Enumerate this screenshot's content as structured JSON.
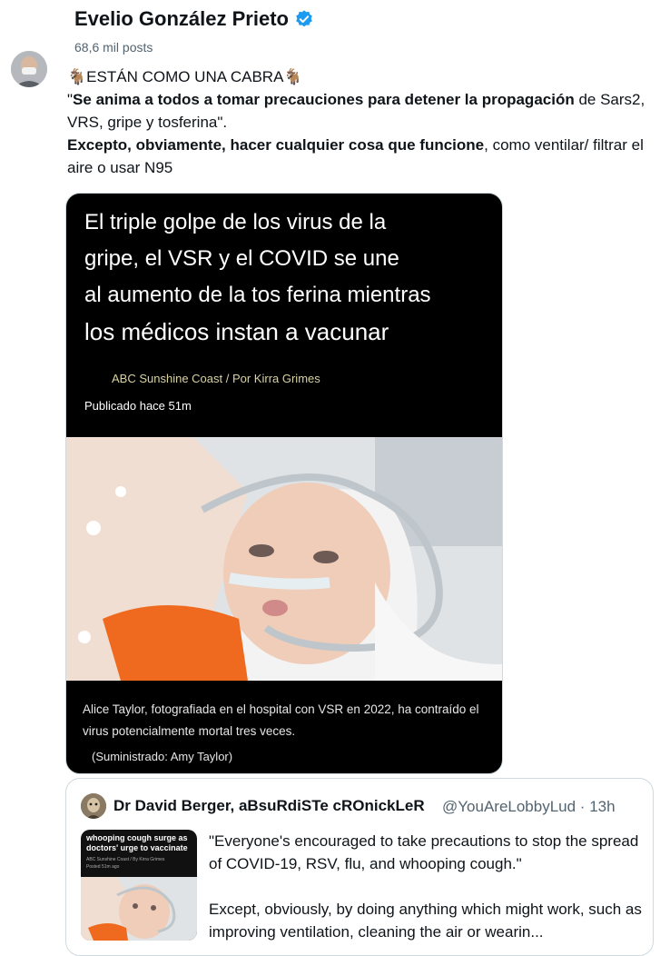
{
  "header": {
    "display_name": "Evelio González Prieto",
    "post_count": "68,6 mil posts"
  },
  "tweet": {
    "line1": "🐐ESTÁN COMO UNA CABRA🐐",
    "quote_open": "\"",
    "bold1": "Se anima a todos a tomar precauciones para detener la propagación",
    "rest1": " de Sars2, VRS, gripe y tosferina\".",
    "bold2": "Excepto, obviamente, hacer cualquier cosa que funcione",
    "rest2": ", como ventilar/ filtrar el aire o usar N95"
  },
  "card": {
    "headline_lines": [
      "El triple golpe de los virus de la",
      "gripe, el VSR y el COVID se une",
      "al aumento de la tos ferina mientras",
      "los médicos instan a vacunar"
    ],
    "source": "ABC Sunshine Coast / Por Kirra Grimes",
    "published": "Publicado hace 51m",
    "caption": "Alice Taylor, fotografiada en el hospital con VSR en 2022, ha contraído el virus potencialmente mortal tres veces.",
    "credit": "(Suministrado: Amy Taylor)"
  },
  "quoted": {
    "name": "Dr David Berger, aBsuRdiSTe cROnickLeR",
    "handle": "@YouAreLobbyLud · 13h",
    "thumb_title": "whooping cough surge as doctors' urge to vaccinate",
    "thumb_source": "ABC Sunshine Coast / By Kirra Grimes",
    "thumb_published": "Posted 51m ago",
    "para1": "\"Everyone's encouraged to take precautions to stop the spread of COVID-19, RSV, flu, and whooping cough.\"",
    "para2": "Except, obviously, by doing anything which might work, such as improving ventilation, cleaning the air or wearin..."
  },
  "colors": {
    "verified_blue": "#1d9bf0",
    "secondary_text": "#536471",
    "card_background": "#000000",
    "source_text": "#d9d2a0"
  },
  "icons": [
    "verified-badge-icon"
  ]
}
